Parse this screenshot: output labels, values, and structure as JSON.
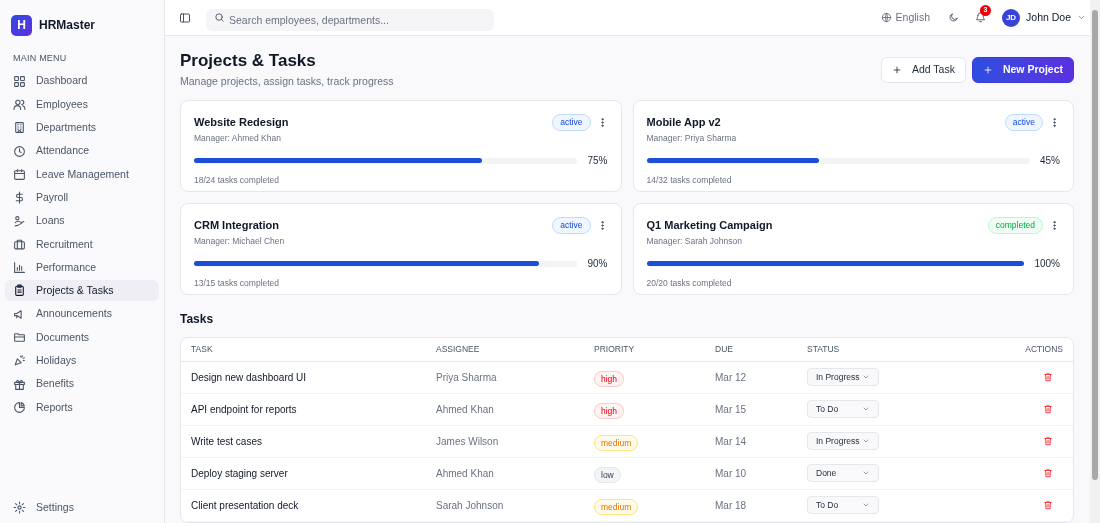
{
  "app": {
    "logo_letter": "H",
    "name": "HRMaster"
  },
  "sidebar": {
    "section_label": "MAIN MENU",
    "items": [
      {
        "label": "Dashboard",
        "selected": false
      },
      {
        "label": "Employees",
        "selected": false
      },
      {
        "label": "Departments",
        "selected": false
      },
      {
        "label": "Attendance",
        "selected": false
      },
      {
        "label": "Leave Management",
        "selected": false
      },
      {
        "label": "Payroll",
        "selected": false
      },
      {
        "label": "Loans",
        "selected": false
      },
      {
        "label": "Recruitment",
        "selected": false
      },
      {
        "label": "Performance",
        "selected": false
      },
      {
        "label": "Projects & Tasks",
        "selected": true
      },
      {
        "label": "Announcements",
        "selected": false
      },
      {
        "label": "Documents",
        "selected": false
      },
      {
        "label": "Holidays",
        "selected": false
      },
      {
        "label": "Benefits",
        "selected": false
      },
      {
        "label": "Reports",
        "selected": false
      }
    ],
    "footer_item": {
      "label": "Settings"
    }
  },
  "topbar": {
    "search_placeholder": "Search employees, departments...",
    "language": "English",
    "notification_count": "3",
    "user": {
      "initials": "JD",
      "name": "John Doe"
    }
  },
  "page": {
    "title": "Projects & Tasks",
    "subtitle": "Manage projects, assign tasks, track progress",
    "buttons": [
      {
        "label": "Add Task",
        "kind": "secondary"
      },
      {
        "label": "New Project",
        "kind": "primary"
      }
    ]
  },
  "projects": [
    {
      "name": "Website Redesign",
      "manager": "Manager: Ahmed Khan",
      "status": "active",
      "level": 0.75,
      "percent": "75%",
      "tasks": "18/24 tasks completed"
    },
    {
      "name": "Mobile App v2",
      "manager": "Manager: Priya Sharma",
      "status": "active",
      "level": 0.45,
      "percent": "45%",
      "tasks": "14/32 tasks completed"
    },
    {
      "name": "CRM Integration",
      "manager": "Manager: Michael Chen",
      "status": "active",
      "level": 0.9,
      "percent": "90%",
      "tasks": "13/15 tasks completed"
    },
    {
      "name": "Q1 Marketing Campaign",
      "manager": "Manager: Sarah Johnson",
      "status": "completed",
      "level": 1,
      "percent": "100%",
      "tasks": "20/20 tasks completed"
    }
  ],
  "tasks": {
    "title": "Tasks",
    "columns": [
      "TASK",
      "ASSIGNEE",
      "PRIORITY",
      "DUE",
      "STATUS",
      "ACTIONS"
    ],
    "rows": [
      {
        "task": "Design new dashboard UI",
        "assignee": "Priya Sharma",
        "priority": "high",
        "due": "Mar 12",
        "status": "In Progress"
      },
      {
        "task": "API endpoint for reports",
        "assignee": "Ahmed Khan",
        "priority": "high",
        "due": "Mar 15",
        "status": "To Do"
      },
      {
        "task": "Write test cases",
        "assignee": "James Wilson",
        "priority": "medium",
        "due": "Mar 14",
        "status": "In Progress"
      },
      {
        "task": "Deploy staging server",
        "assignee": "Ahmed Khan",
        "priority": "low",
        "due": "Mar 10",
        "status": "Done"
      },
      {
        "task": "Client presentation deck",
        "assignee": "Sarah Johnson",
        "priority": "medium",
        "due": "Mar 18",
        "status": "To Do"
      }
    ]
  }
}
